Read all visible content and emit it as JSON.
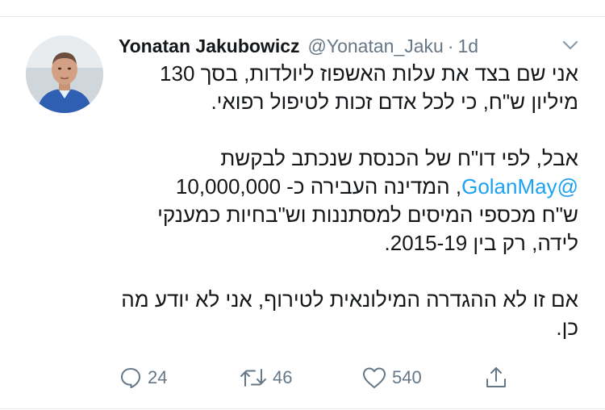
{
  "tweet": {
    "author_name": "Yonatan Jakubowicz",
    "handle": "@Yonatan_Jaku",
    "separator": "·",
    "time": "1d",
    "lines": {
      "l1": "אני שם בצד את עלות האשפוז ליולדות, בסך 130",
      "l2": "מיליון ש\"ח, כי לכל אדם זכות לטיפול רפואי.",
      "l3": "אבל, לפי דו\"ח של הכנסת שנכתב לבקשת",
      "l4_mention": "@GolanMay",
      "l4_rest": ", המדינה העבירה כ- 10,000,000",
      "l5": "ש\"ח מכספי המיסים למסתננות וש\"בחיות כמענקי",
      "l6": "לידה, רק בין 2015-19.",
      "l7": "אם זו לא ההגדרה המילונאית לטירוף, אני לא יודע מה",
      "l8": "כן."
    },
    "mention_color": "#1da1f2"
  },
  "actions": {
    "replies": "24",
    "retweets": "46",
    "likes": "540",
    "icons": [
      "reply-icon",
      "retweet-icon",
      "like-icon",
      "share-icon"
    ]
  }
}
